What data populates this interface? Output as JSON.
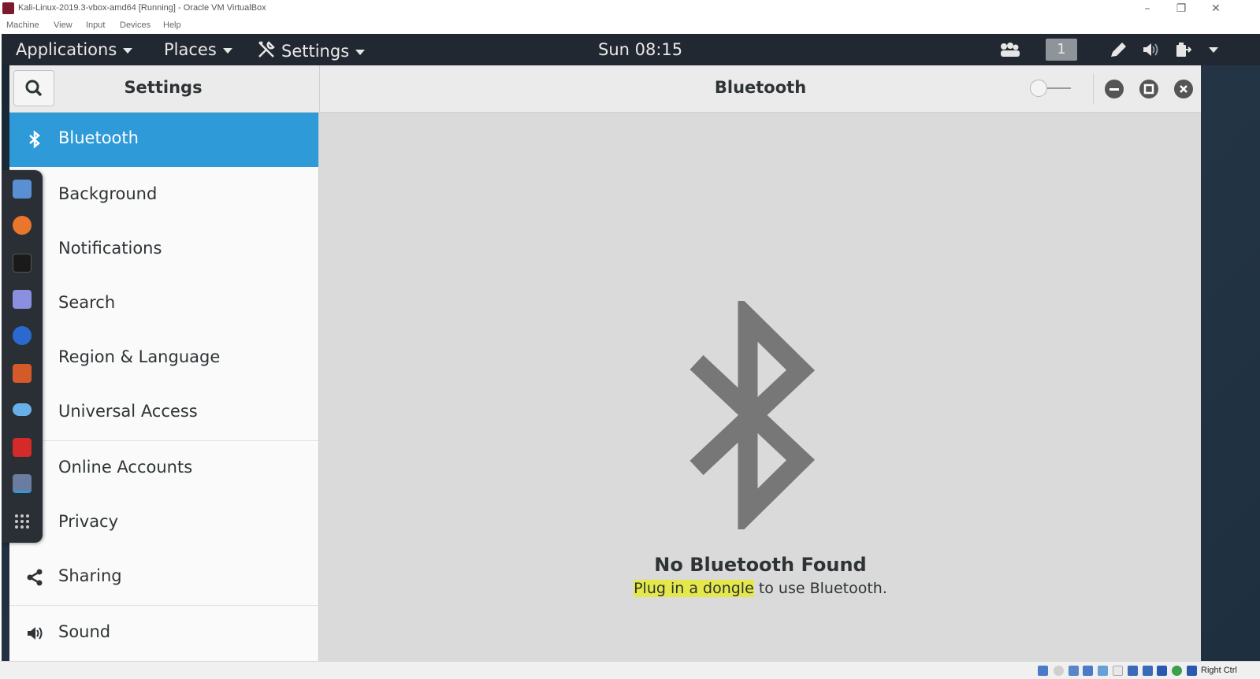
{
  "host": {
    "title": "Kali-Linux-2019.3-vbox-amd64 [Running] - Oracle VM VirtualBox",
    "menu": [
      "Machine",
      "View",
      "Input",
      "Devices",
      "Help"
    ],
    "host_key": "Right Ctrl"
  },
  "topbar": {
    "applications": "Applications",
    "places": "Places",
    "settings": "Settings",
    "clock": "Sun 08:15",
    "workspace": "1"
  },
  "settings_window": {
    "sidebar_title": "Settings",
    "panel_title": "Bluetooth",
    "sidebar_items": [
      {
        "label": "Bluetooth",
        "icon": "bluetooth-icon",
        "active": true
      },
      {
        "label": "Background",
        "icon": "background-icon"
      },
      {
        "label": "Notifications",
        "icon": "notifications-icon"
      },
      {
        "label": "Search",
        "icon": "search-icon"
      },
      {
        "label": "Region & Language",
        "icon": "region-icon"
      },
      {
        "label": "Universal Access",
        "icon": "universal-access-icon"
      },
      {
        "label": "Online Accounts",
        "icon": "online-accounts-icon"
      },
      {
        "label": "Privacy",
        "icon": "privacy-icon"
      },
      {
        "label": "Sharing",
        "icon": "share-icon"
      },
      {
        "label": "Sound",
        "icon": "speaker-icon"
      }
    ],
    "content": {
      "heading": "No Bluetooth Found",
      "sub_highlight": "Plug in a dongle",
      "sub_rest": " to use Bluetooth."
    }
  },
  "colors": {
    "accent": "#2e9ad8",
    "topbar": "#222831",
    "highlight": "#e5e84a"
  }
}
